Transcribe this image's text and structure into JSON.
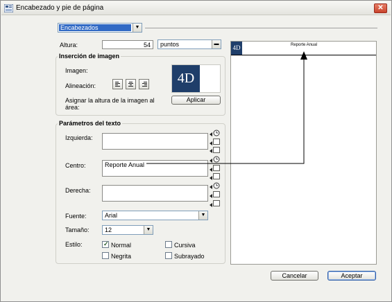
{
  "window": {
    "title": "Encabezado y pie de página",
    "close_glyph": "✕"
  },
  "section_select": {
    "value": "Encabezados"
  },
  "altura": {
    "label": "Altura:",
    "value": "54",
    "unit": "puntos"
  },
  "image": {
    "group_title": "Inserción de imagen",
    "image_label": "Imagen:",
    "align_label": "Alineación:",
    "assign_label_line1": "Asignar la altura de la imagen al",
    "assign_label_line2": "área:",
    "apply_button": "Aplicar",
    "logo_text": "4D"
  },
  "text_params": {
    "group_title": "Parámetros del texto",
    "left_label": "Izquierda:",
    "left_value": "",
    "center_label": "Centro:",
    "center_value": "Reporte Anual",
    "right_label": "Derecha:",
    "right_value": "",
    "font_label": "Fuente:",
    "font_value": "Arial",
    "size_label": "Tamaño:",
    "size_value": "12",
    "style_label": "Estilo:",
    "styles": {
      "normal": {
        "label": "Normal",
        "checked": true
      },
      "cursiva": {
        "label": "Cursiva",
        "checked": false
      },
      "negrita": {
        "label": "Negrita",
        "checked": false
      },
      "subrayado": {
        "label": "Subrayado",
        "checked": false
      }
    }
  },
  "preview": {
    "logo_text": "4D",
    "center_text": "Reporte Anual"
  },
  "buttons": {
    "cancel": "Cancelar",
    "accept": "Aceptar"
  },
  "icons": [
    "app-icon",
    "close-icon",
    "align-left-icon",
    "align-center-icon",
    "align-right-icon",
    "clock-icon",
    "page-number-icon",
    "date-icon"
  ],
  "colors": {
    "logo_blue": "#1f3e6a",
    "selection_blue": "#316ac5"
  }
}
